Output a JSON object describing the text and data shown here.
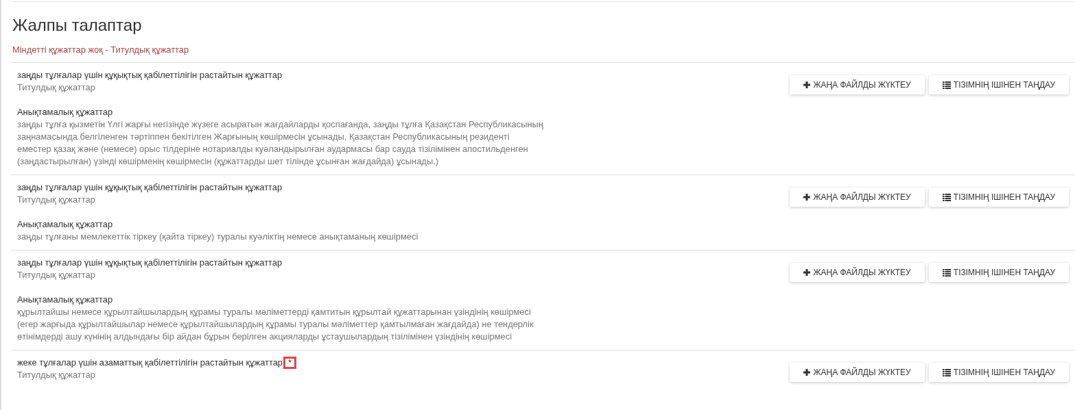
{
  "heading": "Жалпы талаптар",
  "notice": "Міндетті құжаттар жоқ - Титулдық құжаттар",
  "documents": [
    {
      "title": "заңды тұлғалар үшін құқықтық қабілеттілігін растайтын құжаттар",
      "required": false,
      "category": "Титулдық құжаттар",
      "reference_title": "Анықтамалық құжаттар",
      "reference_text": "заңды тұлға қызметін Үлгі жарғы негізінде жүзеге асыратын жағдайларды қоспағанда, заңды тұлға Қазақстан Республикасының заңнамасында белгіленген тәртіппен бекітілген Жарғының көшірмесін ұсынады, Қазақстан Республикасының резиденті еместер қазақ және (немесе) орыс тілдеріне нотариалды куәландырылған аудармасы бар сауда тізілімінен апостильденген (заңдастырылған) үзінді көшірменің көшірмесін (құжаттарды шет тілінде ұсынған жағдайда) ұсынады.)",
      "upload_button": "ЖАҢА ФАЙЛДЫ ЖҮКТЕУ",
      "select_button": "ТІЗІМНІҢ ІШІНЕН ТАҢДАУ"
    },
    {
      "title": "заңды тұлғалар үшін құқықтық қабілеттілігін растайтын құжаттар",
      "required": false,
      "category": "Титулдық құжаттар",
      "reference_title": "Анықтамалық құжаттар",
      "reference_text": "заңды тұлғаны мемлекеттік тіркеу (қайта тіркеу) туралы куәліктің немесе анықтаманың көшірмесі",
      "upload_button": "ЖАҢА ФАЙЛДЫ ЖҮКТЕУ",
      "select_button": "ТІЗІМНІҢ ІШІНЕН ТАҢДАУ"
    },
    {
      "title": "заңды тұлғалар үшін құқықтық қабілеттілігін растайтын құжаттар",
      "required": false,
      "category": "Титулдық құжаттар",
      "reference_title": "Анықтамалық құжаттар",
      "reference_text": "құрылтайшы немесе құрылтайшылардың құрамы туралы мәліметтерді қамтитын құрылтай құжаттарынан үзіндінің көшірмесі (егер жарғыда құрылтайшылар немесе құрылтайшылардың құрамы туралы мәліметтер қамтылмаған жағдайда) не тендерлік өтінімдерді ашу күнінің алдындағы бір айдан бұрын берілген акцияларды ұстаушылардың тізілімінен үзіндінің көшірмесі",
      "upload_button": "ЖАҢА ФАЙЛДЫ ЖҮКТЕУ",
      "select_button": "ТІЗІМНІҢ ІШІНЕН ТАҢДАУ"
    },
    {
      "title": "жеке тұлғалар үшін азаматтық қабілеттілігін растайтын құжаттар",
      "required": true,
      "required_mark": "*",
      "category": "Титулдық құжаттар",
      "upload_button": "ЖАҢА ФАЙЛДЫ ЖҮКТЕУ",
      "select_button": "ТІЗІМНІҢ ІШІНЕН ТАҢДАУ"
    }
  ]
}
